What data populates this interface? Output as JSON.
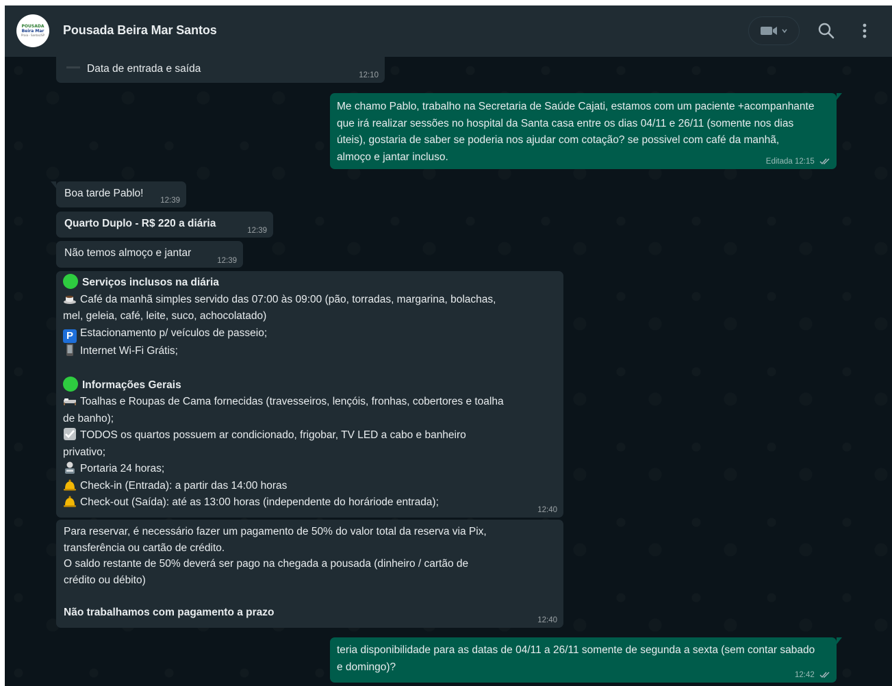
{
  "header": {
    "contact_name": "Pousada Beira Mar Santos",
    "avatar_text": [
      "POUSADA",
      "Beira Mar",
      "Praia - Santos/SP"
    ],
    "icons": [
      "video-call-icon",
      "chevron-down-icon",
      "search-icon",
      "menu-icon"
    ]
  },
  "messages": [
    {
      "id": "m0",
      "dir": "in",
      "text": "Data de entrada e saída",
      "time": "12:10"
    },
    {
      "id": "m1",
      "dir": "out",
      "text": "Me chamo Pablo, trabalho na Secretaria de Saúde Cajati,  estamos com um paciente +acompanhante que irá realizar sessões no hospital da Santa casa entre os dias 04/11 e 26/11 (somente nos dias úteis), gostaria de saber se poderia nos ajudar com cotação? se possivel com café da manhã, almoço e jantar incluso.",
      "edited": "Editada",
      "time": "12:15",
      "status": "read"
    },
    {
      "id": "m2",
      "dir": "in",
      "text": "Boa tarde Pablo!",
      "time": "12:39"
    },
    {
      "id": "m3",
      "dir": "in",
      "text": "Quarto Duplo - R$ 220 a diária",
      "time": "12:39"
    },
    {
      "id": "m4",
      "dir": "in",
      "text": "Não temos almoço e jantar",
      "time": "12:39"
    },
    {
      "id": "m5",
      "dir": "in",
      "time": "12:40",
      "section1_title": "Serviços inclusos na diária",
      "s1_line1": "Café da manhã simples servido das 07:00 às 09:00 (pão, torradas, margarina, bolachas,",
      "s1_line1b": "mel,  geleia, café, leite, suco, achocolatado)",
      "s1_line2": "Estacionamento p/ veículos de passeio;",
      "s1_line3": "Internet Wi-Fi Grátis;",
      "section2_title": "Informações Gerais",
      "s2_line1": "Toalhas e Roupas de Cama fornecidas (travesseiros, lençóis, fronhas, cobertores e toalha",
      "s2_line1b": "de banho);",
      "s2_line2": "TODOS os quartos possuem ar condicionado, frigobar, TV LED a cabo e banheiro",
      "s2_line2b": "privativo;",
      "s2_line3": "Portaria 24 horas;",
      "s2_line4": "Check-in (Entrada): a partir das 14:00 horas",
      "s2_line5": "Check-out (Saída): até as 13:00 horas (independente do horáriode entrada);"
    },
    {
      "id": "m6",
      "dir": "in",
      "time": "12:40",
      "p1a": "Para reservar, é necessário fazer um pagamento de 50% do valor total da reserva via Pix,",
      "p1b": "transferência ou cartão de crédito.",
      "p2a": "O saldo restante de 50% deverá ser pago na chegada a pousada (dinheiro / cartão de",
      "p2b": "crédito ou débito)",
      "p3": "Não trabalhamos com pagamento a prazo"
    },
    {
      "id": "m7",
      "dir": "out",
      "text": "teria disponibilidade para as datas de 04/11 a 26/11 somente de segunda a sexta (sem contar sabado e domingo)?",
      "time": "12:42",
      "status": "read"
    }
  ],
  "colors": {
    "incoming_bubble": "#202c33",
    "outgoing_bubble": "#005c4b",
    "background": "#0b141a",
    "emoji_green": "#2ecc40",
    "parking_blue": "#1e6fd9"
  }
}
